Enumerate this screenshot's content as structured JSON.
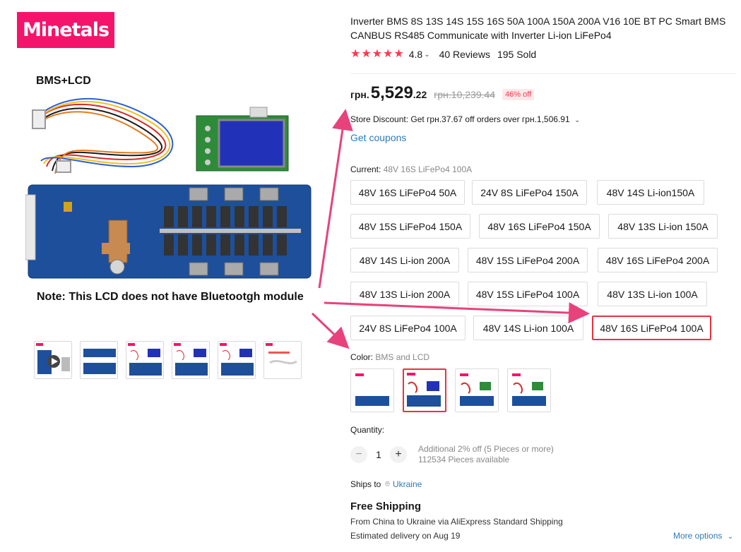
{
  "brand": {
    "logo_text": "Minetals"
  },
  "gallery": {
    "caption_top": "BMS+LCD",
    "caption_bottom": "Note: This LCD does not have Bluetootgh module",
    "thumbnail_count": 6
  },
  "product": {
    "title": "Inverter BMS 8S 13S 14S 15S 16S 50A 100A 150A 200A V16 10E BT PC Smart BMS CANBUS RS485 Communicate with Inverter Li-ion LiFePo4",
    "rating": "4.8",
    "reviews": "40 Reviews",
    "sold": "195 Sold"
  },
  "price": {
    "currency": "грн.",
    "big": "5,529",
    "small": ".22",
    "old": "грн.10,239.44",
    "discount": "46% off"
  },
  "store_discount": "Store Discount: Get грн.37.67 off orders over грн.1,506.91",
  "coupons_label": "Get coupons",
  "variants": {
    "label": "Current:",
    "current": "48V 16S LiFePo4 100A",
    "options": [
      "48V 16S LiFePo4 50A",
      "24V 8S LiFePo4 150A",
      "48V 14S Li-ion150A",
      "48V 15S LiFePo4 150A",
      "48V 16S LiFePo4 150A",
      "48V 13S Li-ion 150A",
      "48V 14S Li-ion 200A",
      "48V 15S LiFePo4 200A",
      "48V 16S LiFePo4 200A",
      "48V 13S Li-ion 200A",
      "48V 15S LiFePo4 100A",
      "48V 13S Li-ion 100A",
      "24V 8S LiFePo4 100A",
      "48V 14S Li-ion 100A",
      "48V 16S LiFePo4 100A"
    ],
    "selected_index": 14
  },
  "color": {
    "label": "Color:",
    "current": "BMS and LCD",
    "selected_index": 1
  },
  "quantity": {
    "label": "Quantity:",
    "value": "1",
    "minus": "−",
    "plus": "+",
    "note1": "Additional 2% off (5 Pieces or more)",
    "note2": "112534 Pieces available"
  },
  "shipping": {
    "ships_to_label": "Ships to",
    "country": "Ukraine",
    "free_label": "Free Shipping",
    "route": "From China to Ukraine via AliExpress Standard Shipping",
    "delivery": "Estimated delivery on Aug 19",
    "more_options": "More options"
  },
  "colors": {
    "accent": "#e4353f",
    "star": "#fd384f",
    "link": "#2e7bb8",
    "brand": "#f4146b",
    "arrow": "#e8427c"
  }
}
